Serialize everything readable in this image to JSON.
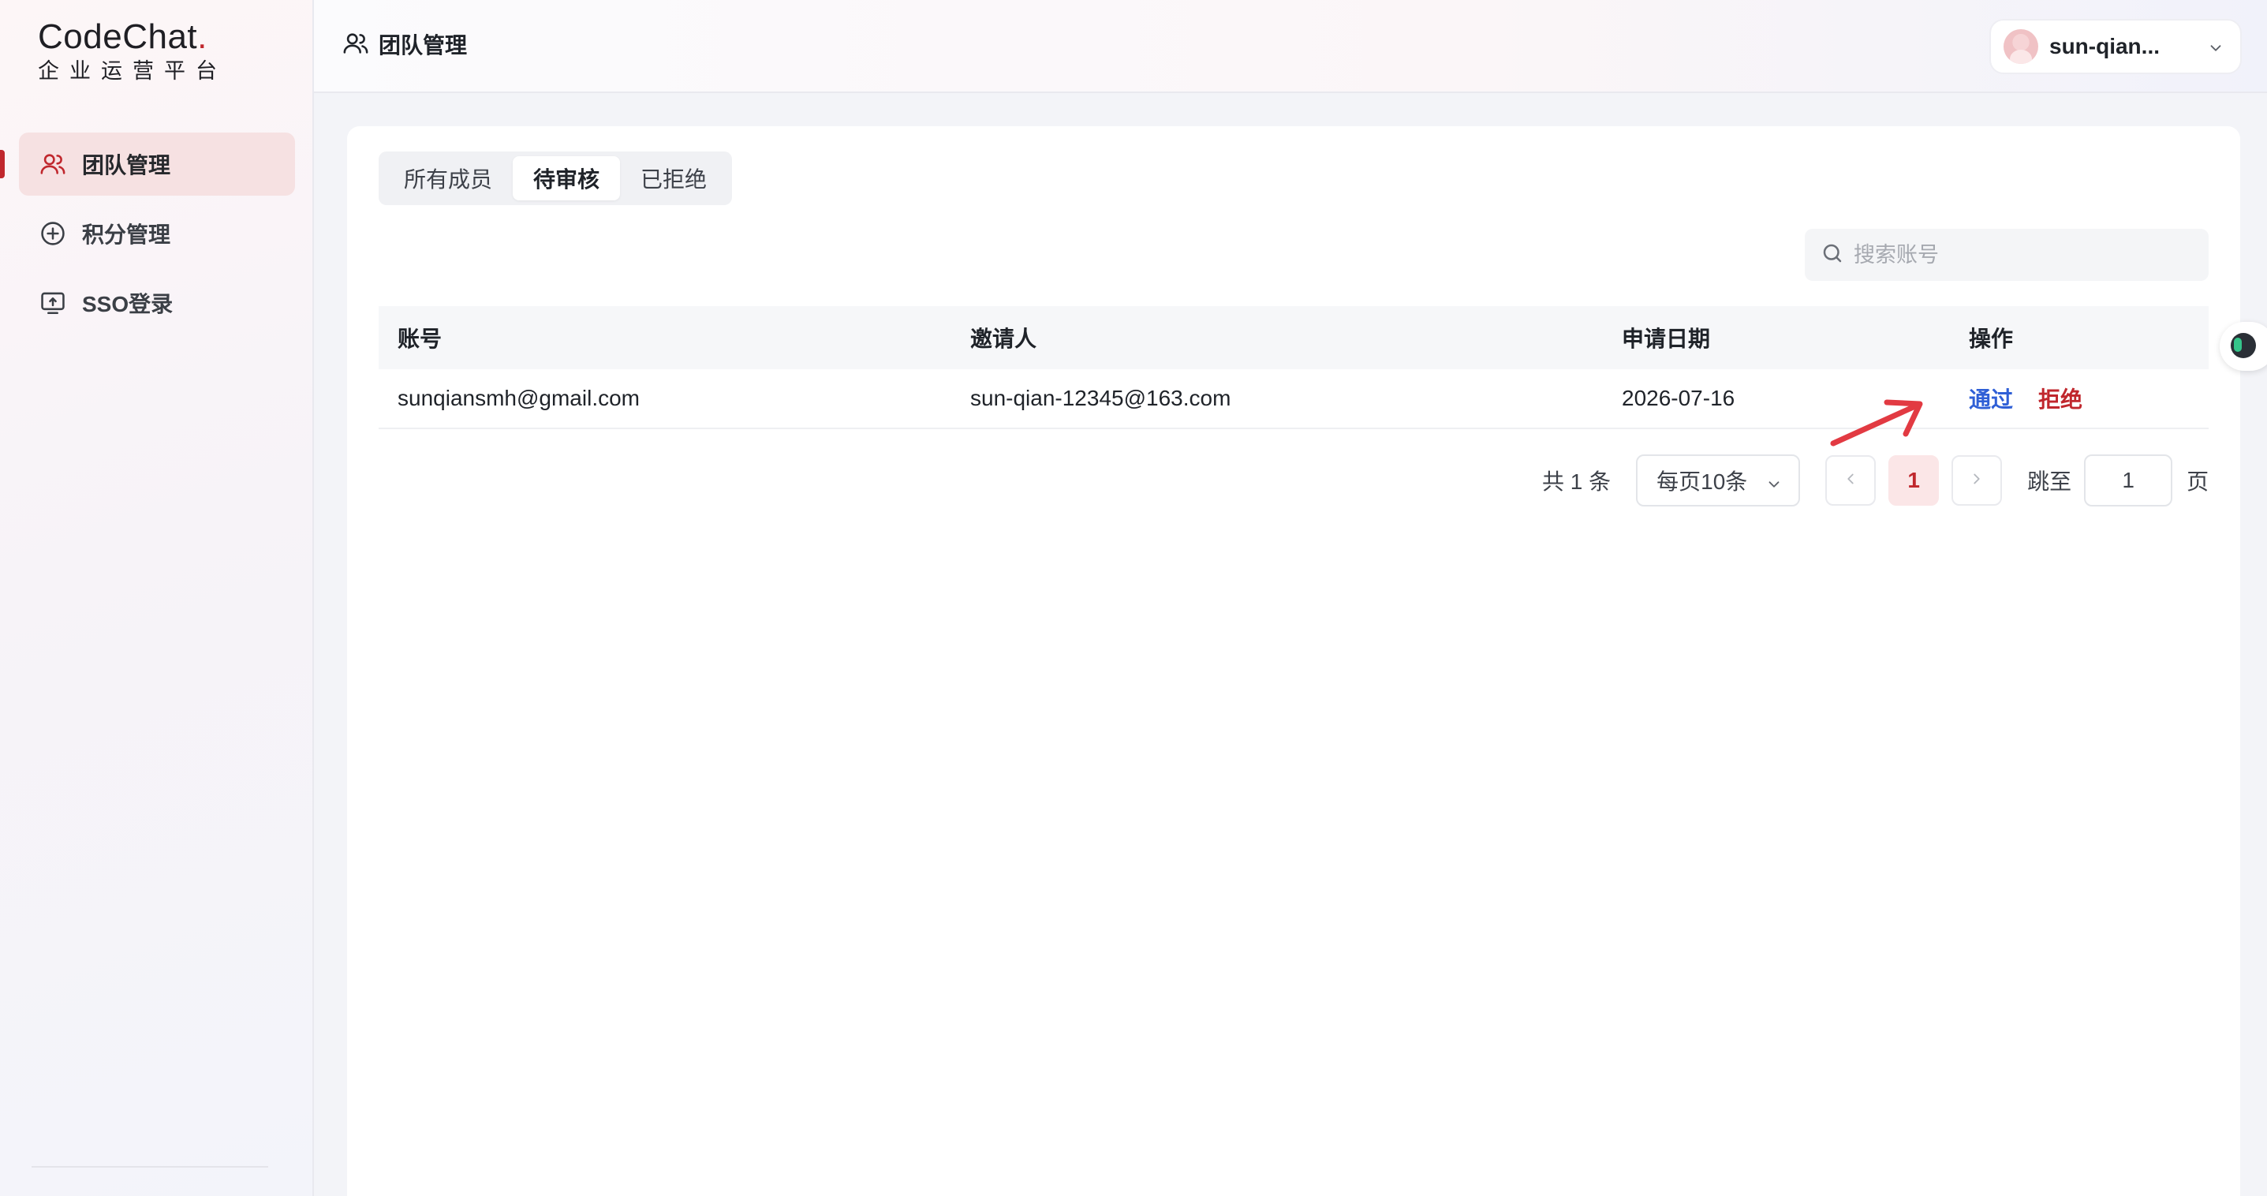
{
  "brand": {
    "logo_main_prefix": "C",
    "logo_main_o": "o",
    "logo_main_suffix": "deChat",
    "logo_dot": ".",
    "logo_sub": "企业运营平台",
    "accent_color": "#c0272d"
  },
  "sidebar": {
    "items": [
      {
        "label": "团队管理",
        "icon": "users-icon",
        "active": true
      },
      {
        "label": "积分管理",
        "icon": "plus-circle-icon",
        "active": false
      },
      {
        "label": "SSO登录",
        "icon": "monitor-upload-icon",
        "active": false
      }
    ]
  },
  "header": {
    "title": "团队管理",
    "user_name": "sun-qian..."
  },
  "tabs": [
    {
      "label": "所有成员",
      "active": false
    },
    {
      "label": "待审核",
      "active": true
    },
    {
      "label": "已拒绝",
      "active": false
    }
  ],
  "search": {
    "placeholder": "搜索账号",
    "value": ""
  },
  "table": {
    "headers": [
      "账号",
      "邀请人",
      "申请日期",
      "操作"
    ],
    "rows": [
      {
        "account": "sunqiansmh@gmail.com",
        "inviter": "sun-qian-12345@163.com",
        "date": "2026-07-16",
        "approve_label": "通过",
        "reject_label": "拒绝"
      }
    ]
  },
  "pagination": {
    "total_text": "共 1 条",
    "page_size": "每页10条",
    "current_page": "1",
    "jump_label": "跳至",
    "jump_value": "1",
    "page_suffix": "页"
  }
}
